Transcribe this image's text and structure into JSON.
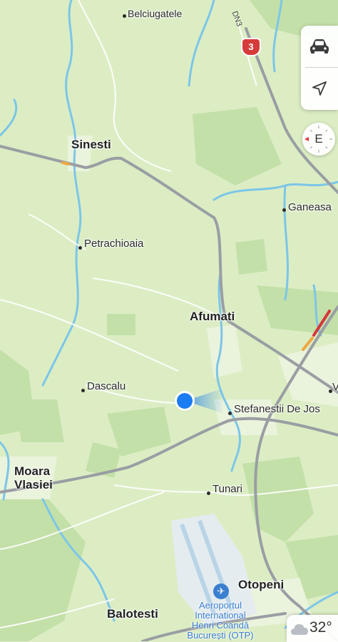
{
  "map": {
    "places": [
      {
        "name": "Belciugatele",
        "style": "small"
      },
      {
        "name": "Sinesti",
        "style": "big"
      },
      {
        "name": "Ganeasa",
        "style": "small"
      },
      {
        "name": "Petrachioaia",
        "style": "small"
      },
      {
        "name": "Afumati",
        "style": "big"
      },
      {
        "name": "Dascalu",
        "style": "small"
      },
      {
        "name": "Stefanestii De Jos",
        "style": "small"
      },
      {
        "name": "Moara Vlasiei",
        "style": "big"
      },
      {
        "name": "Tunari",
        "style": "small"
      },
      {
        "name": "Otopeni",
        "style": "big"
      },
      {
        "name": "Balotesti",
        "style": "big"
      }
    ],
    "road": {
      "shield": "3",
      "name": "DN3"
    },
    "airport": {
      "line1": "Aeroportul",
      "line2": "International",
      "line3": "Henri Coandă",
      "line4": "București (OTP)"
    },
    "partial_label": "V"
  },
  "controls": {
    "drive_icon": "car-icon",
    "location_icon": "location-arrow-icon",
    "compass": "E"
  },
  "weather": {
    "icon": "cloud-icon",
    "temperature": "32°"
  }
}
